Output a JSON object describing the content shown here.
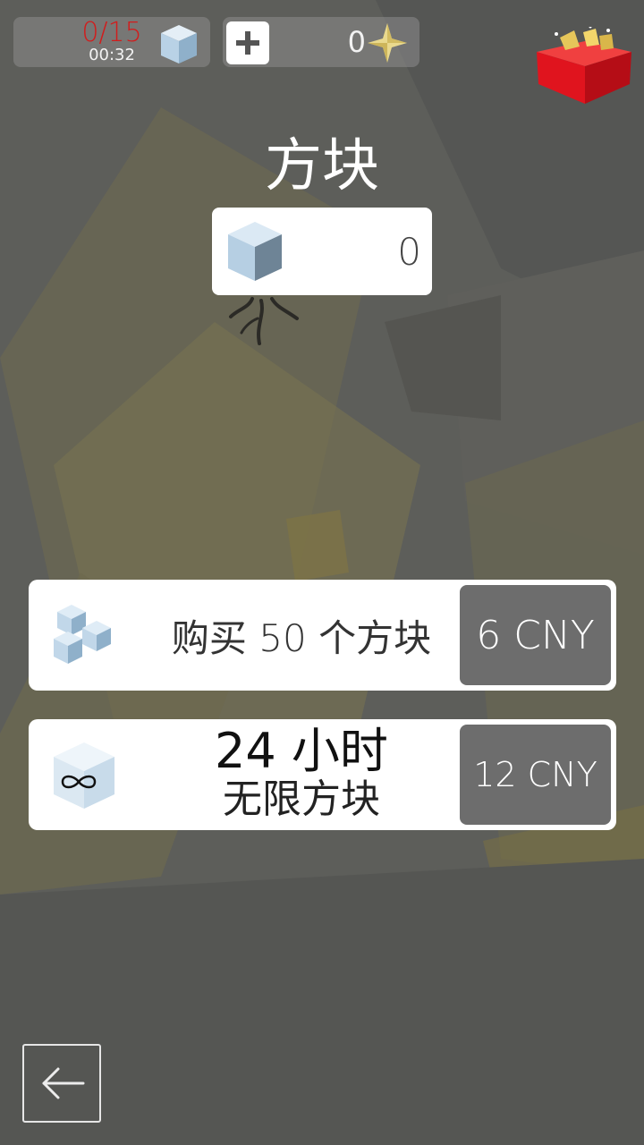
{
  "hud": {
    "level_progress": "0/15",
    "timer": "00:32",
    "stars_count": "0"
  },
  "screen": {
    "title": "方块",
    "blocks_count": "0"
  },
  "offers": [
    {
      "label": "购买 50 个方块",
      "price": "6 CNY"
    },
    {
      "label_line1": "24 小时",
      "label_line2": "无限方块",
      "price": "12 CNY"
    }
  ],
  "icons": {
    "blocks": "cube-icon",
    "stars": "star-icon",
    "add": "plus-icon",
    "gift": "gift-box-icon",
    "bundle": "cube-stack-icon",
    "unlimited": "infinity-cube-icon",
    "back": "arrow-left-icon"
  },
  "colors": {
    "counter_red": "#d21c1c",
    "card_white": "#ffffff",
    "price_gray": "#6d6d6d",
    "cube_light": "#c3d9ea",
    "cube_dark": "#6e8496",
    "gift_red": "#e0141e",
    "star_gold": "#e8d27a"
  }
}
